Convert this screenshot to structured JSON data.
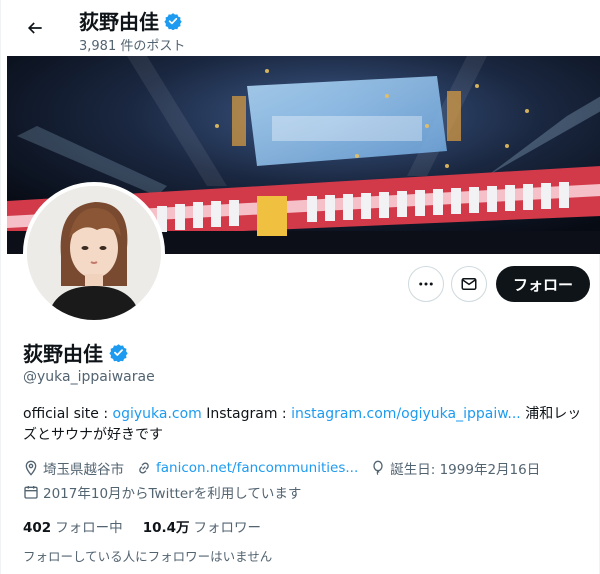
{
  "header": {
    "display_name": "荻野由佳",
    "post_count": "3,981 件のポスト"
  },
  "profile": {
    "display_name": "荻野由佳",
    "handle": "@yuka_ippaiwarae",
    "verified": true
  },
  "actions": {
    "follow_label": "フォロー"
  },
  "bio": {
    "text1": "official site : ",
    "link1": "ogiyuka.com",
    "text2": " Instagram : ",
    "link2": "instagram.com/ogiyuka_ippaiw...",
    "text3": " 浦和レッズとサウナが好きです"
  },
  "meta": {
    "location": "埼玉県越谷市",
    "website": "fanicon.net/fancommunities...",
    "birthday": "誕生日: 1999年2月16日",
    "joined": "2017年10月からTwitterを利用しています"
  },
  "stats": {
    "following_count": "402",
    "following_label": "フォロー中",
    "followers_count": "10.4万",
    "followers_label": "フォロワー"
  },
  "followed_by": "フォローしている人にフォロワーはいません",
  "colors": {
    "accent": "#1d9bf0",
    "text": "#0f1419",
    "muted": "#536471",
    "verified_badge": "#1d9bf0"
  },
  "icons": [
    "back-arrow-icon",
    "verified-badge-icon",
    "more-icon",
    "mail-icon",
    "location-pin-icon",
    "link-icon",
    "balloon-icon",
    "calendar-icon"
  ]
}
